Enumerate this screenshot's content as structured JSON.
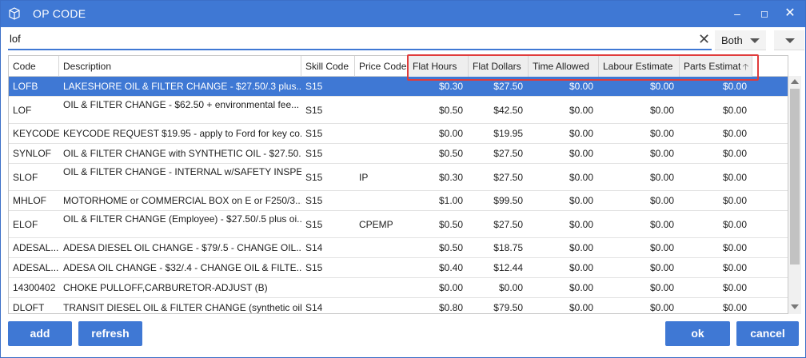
{
  "window": {
    "title": "OP CODE"
  },
  "search": {
    "value": "lof"
  },
  "filter": {
    "selected": "Both"
  },
  "grid": {
    "columns": [
      "Code",
      "Description",
      "Skill Code",
      "Price Code",
      "Flat Hours",
      "Flat Dollars",
      "Time Allowed",
      "Labour Estimate",
      "Parts Estimat"
    ],
    "rows": [
      [
        "LOFB",
        "LAKESHORE OIL & FILTER CHANGE - $27.50/.3 plus...",
        "S15",
        "",
        "$0.30",
        "$27.50",
        "$0.00",
        "$0.00",
        "$0.00"
      ],
      [
        "LOF",
        "OIL & FILTER CHANGE - $62.50 + environmental fee...",
        "S15",
        "",
        "$0.50",
        "$42.50",
        "$0.00",
        "$0.00",
        "$0.00"
      ],
      [
        "KEYCODE",
        "KEYCODE REQUEST $19.95 - apply to Ford for key co...",
        "S15",
        "",
        "$0.00",
        "$19.95",
        "$0.00",
        "$0.00",
        "$0.00"
      ],
      [
        "SYNLOF",
        "OIL & FILTER CHANGE with SYNTHETIC OIL - $27.50...",
        "S15",
        "",
        "$0.50",
        "$27.50",
        "$0.00",
        "$0.00",
        "$0.00"
      ],
      [
        "SLOF",
        "OIL & FILTER CHANGE - INTERNAL w/SAFETY INSPE...",
        "S15",
        "IP",
        "$0.30",
        "$27.50",
        "$0.00",
        "$0.00",
        "$0.00"
      ],
      [
        "MHLOF",
        "MOTORHOME or COMMERCIAL BOX on E or F250/3...",
        "S15",
        "",
        "$1.00",
        "$99.50",
        "$0.00",
        "$0.00",
        "$0.00"
      ],
      [
        "ELOF",
        "OIL & FILTER CHANGE (Employee) - $27.50/.5 plus oi...",
        "S15",
        "CPEMP",
        "$0.50",
        "$27.50",
        "$0.00",
        "$0.00",
        "$0.00"
      ],
      [
        "ADESAL...",
        "ADESA DIESEL OIL CHANGE - $79/.5 - CHANGE OIL...",
        "S14",
        "",
        "$0.50",
        "$18.75",
        "$0.00",
        "$0.00",
        "$0.00"
      ],
      [
        "ADESAL...",
        "ADESA OIL CHANGE - $32/.4 - CHANGE OIL & FILTE...",
        "S15",
        "",
        "$0.40",
        "$12.44",
        "$0.00",
        "$0.00",
        "$0.00"
      ],
      [
        "14300402",
        "CHOKE PULLOFF,CARBURETOR-ADJUST (B)",
        "",
        "",
        "$0.00",
        "$0.00",
        "$0.00",
        "$0.00",
        "$0.00"
      ],
      [
        "DLOFT",
        "TRANSIT DIESEL OIL & FILTER CHANGE (synthetic oil...",
        "S14",
        "",
        "$0.80",
        "$79.50",
        "$0.00",
        "$0.00",
        "$0.00"
      ]
    ]
  },
  "buttons": {
    "add": "add",
    "refresh": "refresh",
    "ok": "ok",
    "cancel": "cancel"
  },
  "colors": {
    "accent": "#3f78d4",
    "highlight_box": "#e03c3c"
  }
}
